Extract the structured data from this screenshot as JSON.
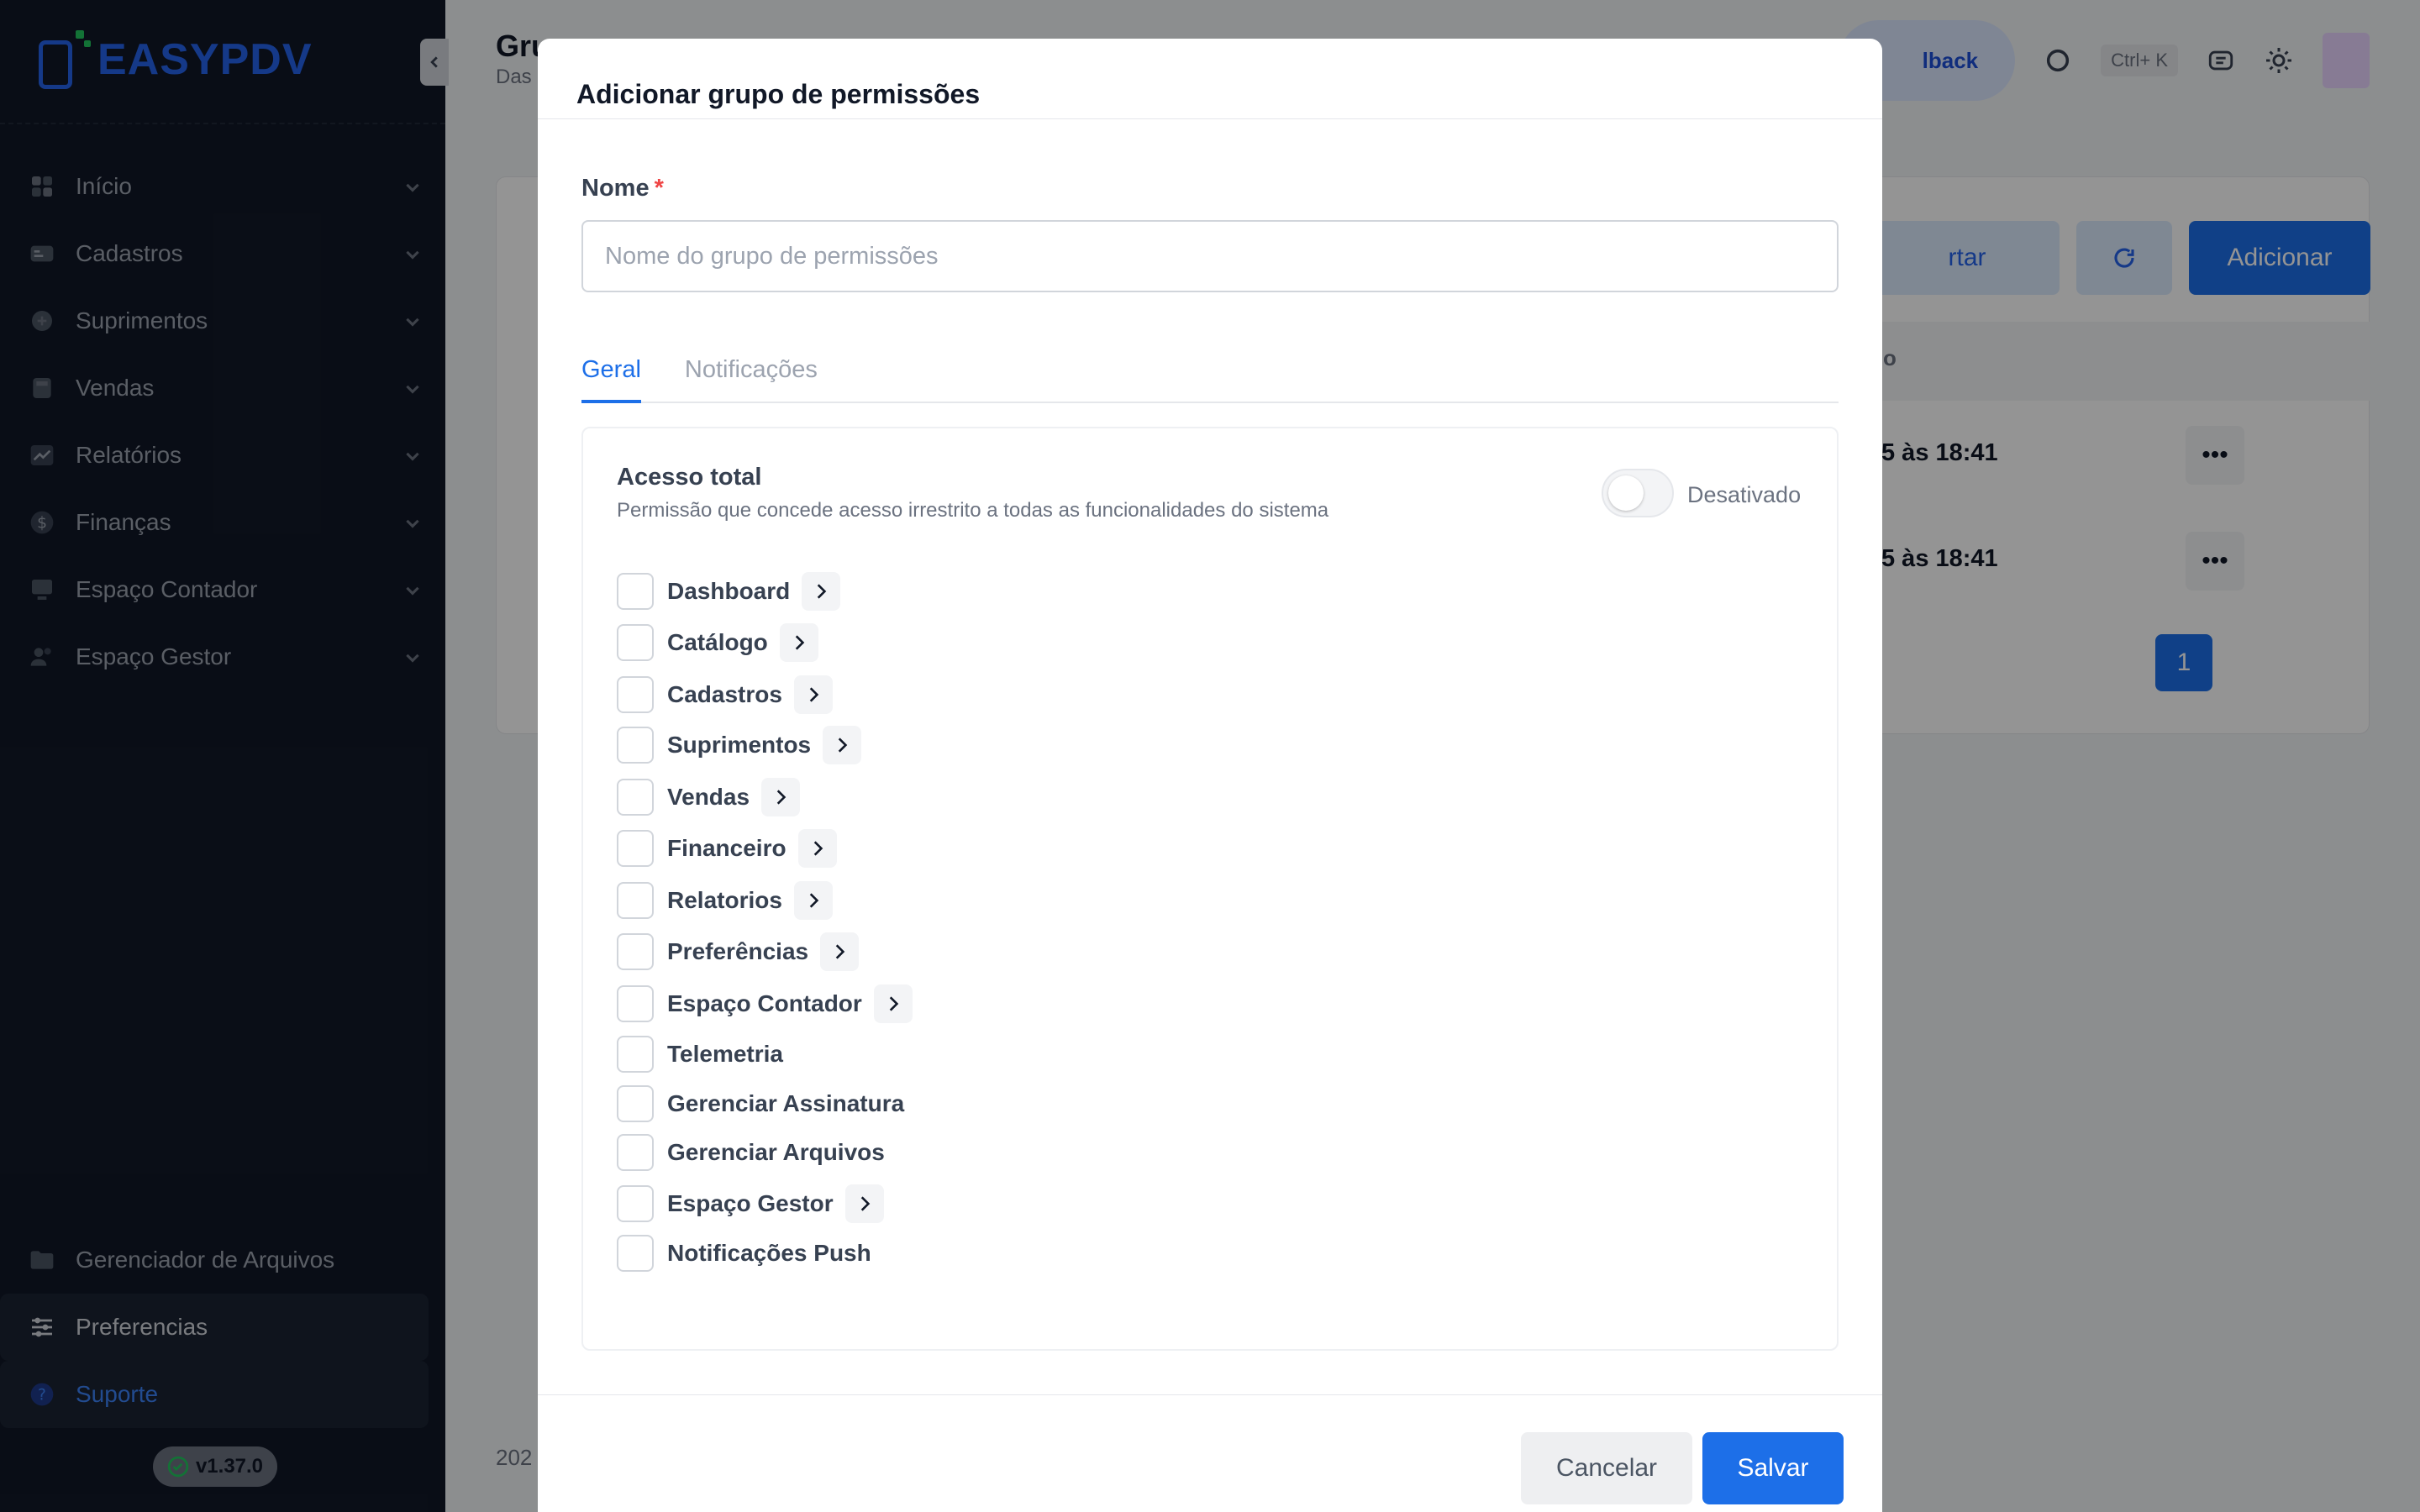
{
  "app": {
    "logo_text": "EASYPDV",
    "version": "v1.37.0"
  },
  "sidebar": {
    "items": [
      {
        "label": "Início",
        "icon": "grid-icon"
      },
      {
        "label": "Cadastros",
        "icon": "id-card-icon"
      },
      {
        "label": "Suprimentos",
        "icon": "box-icon"
      },
      {
        "label": "Vendas",
        "icon": "register-icon"
      },
      {
        "label": "Relatórios",
        "icon": "trend-icon"
      },
      {
        "label": "Finanças",
        "icon": "dollar-icon"
      },
      {
        "label": "Espaço Contador",
        "icon": "monitor-icon"
      },
      {
        "label": "Espaço Gestor",
        "icon": "users-icon"
      }
    ],
    "bottom_items": [
      {
        "label": "Gerenciador de Arquivos",
        "icon": "folder-icon"
      },
      {
        "label": "Preferencias",
        "icon": "sliders-icon"
      },
      {
        "label": "Suporte",
        "icon": "help-icon"
      }
    ]
  },
  "page": {
    "title": "Gru",
    "breadcrumb": "Das",
    "feedback_label": "lback",
    "shortcut": "Ctrl+ K",
    "import_label": "rtar",
    "add_label": "Adicionar",
    "table_header_partial": "o",
    "row1_date": "5 às 18:41",
    "row2_date": "5 às 18:41",
    "page_number": "1",
    "footer_year": "202"
  },
  "modal": {
    "title": "Adicionar grupo de permissões",
    "name_label": "Nome",
    "required_mark": "*",
    "name_placeholder": "Nome do grupo de permissões",
    "name_value": "",
    "tabs": [
      {
        "label": "Geral",
        "active": true
      },
      {
        "label": "Notificações",
        "active": false
      }
    ],
    "full_access": {
      "title": "Acesso total",
      "description": "Permissão que concede acesso irrestrito a todas as funcionalidades do sistema",
      "toggle_state": "Desativado",
      "enabled": false
    },
    "permissions": [
      {
        "label": "Dashboard",
        "expandable": true,
        "checked": false
      },
      {
        "label": "Catálogo",
        "expandable": true,
        "checked": false
      },
      {
        "label": "Cadastros",
        "expandable": true,
        "checked": false
      },
      {
        "label": "Suprimentos",
        "expandable": true,
        "checked": false
      },
      {
        "label": "Vendas",
        "expandable": true,
        "checked": false
      },
      {
        "label": "Financeiro",
        "expandable": true,
        "checked": false
      },
      {
        "label": "Relatorios",
        "expandable": true,
        "checked": false
      },
      {
        "label": "Preferências",
        "expandable": true,
        "checked": false
      },
      {
        "label": "Espaço Contador",
        "expandable": true,
        "checked": false
      },
      {
        "label": "Telemetria",
        "expandable": false,
        "checked": false
      },
      {
        "label": "Gerenciar Assinatura",
        "expandable": false,
        "checked": false
      },
      {
        "label": "Gerenciar Arquivos",
        "expandable": false,
        "checked": false
      },
      {
        "label": "Espaço Gestor",
        "expandable": true,
        "checked": false
      },
      {
        "label": "Notificações Push",
        "expandable": false,
        "checked": false
      }
    ],
    "cancel_label": "Cancelar",
    "save_label": "Salvar"
  },
  "colors": {
    "primary": "#1d6fe8",
    "sidebar_bg": "#111827",
    "required": "#ef4444"
  }
}
